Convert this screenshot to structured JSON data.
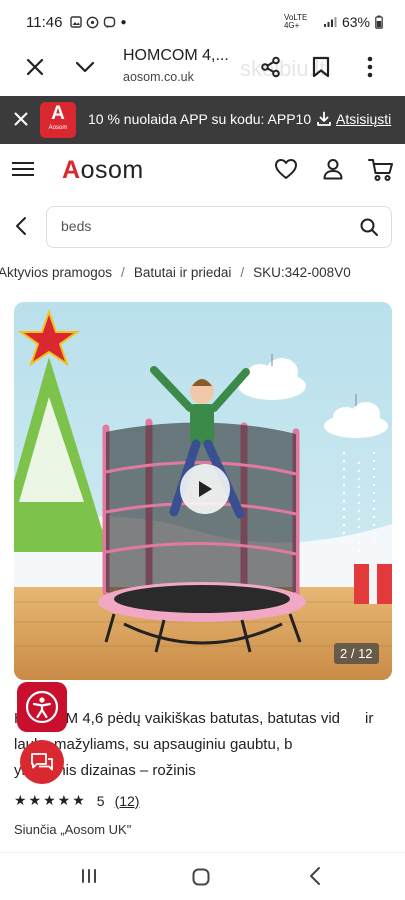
{
  "status_bar": {
    "time": "11:46",
    "notif_icons": [
      "image-icon",
      "whatsapp-icon",
      "viber-icon",
      "dot-icon"
    ],
    "network": "VoLTE 4G+",
    "battery": "63%"
  },
  "browser": {
    "tab_title": "HOMCOM 4,...",
    "url": "aosom.co.uk",
    "watermark": "skelbiu.lt"
  },
  "app_banner": {
    "logo_letter": "A",
    "logo_name": "Aosom",
    "promo_text": "10 % nuolaida APP su kodu: APP10",
    "download_label": "Atsisiųsti"
  },
  "header": {
    "logo_first": "A",
    "logo_rest": "osom"
  },
  "search": {
    "value": "beds"
  },
  "breadcrumb": [
    "Aktyvios pramogos",
    "Batutai ir priedai",
    "SKU:342-008V0"
  ],
  "gallery": {
    "counter": "2 / 12"
  },
  "product": {
    "title": "HOMCOM 4,6 pėdų vaikiškas batutas, batutas viduje ir lauke mažyliams, su apsauginiu gaubtu, būrų spyruoklinis dizainas – rožinis",
    "title_visible": "H       OM 4,6 pėdų vaikiškas batutas, batutas vid      ir lauke mažyliams, su apsauginiu gaubtu, b      yruoklinis dizainas – rožinis",
    "stars": "★★★★★",
    "rating": "5",
    "review_count": "(12)",
    "seller": "Siunčia „Aosom UK\""
  },
  "colors": {
    "brand_red": "#d9282f",
    "banner_bg": "#3b3b3b",
    "accessibility_red": "#c8102e"
  }
}
